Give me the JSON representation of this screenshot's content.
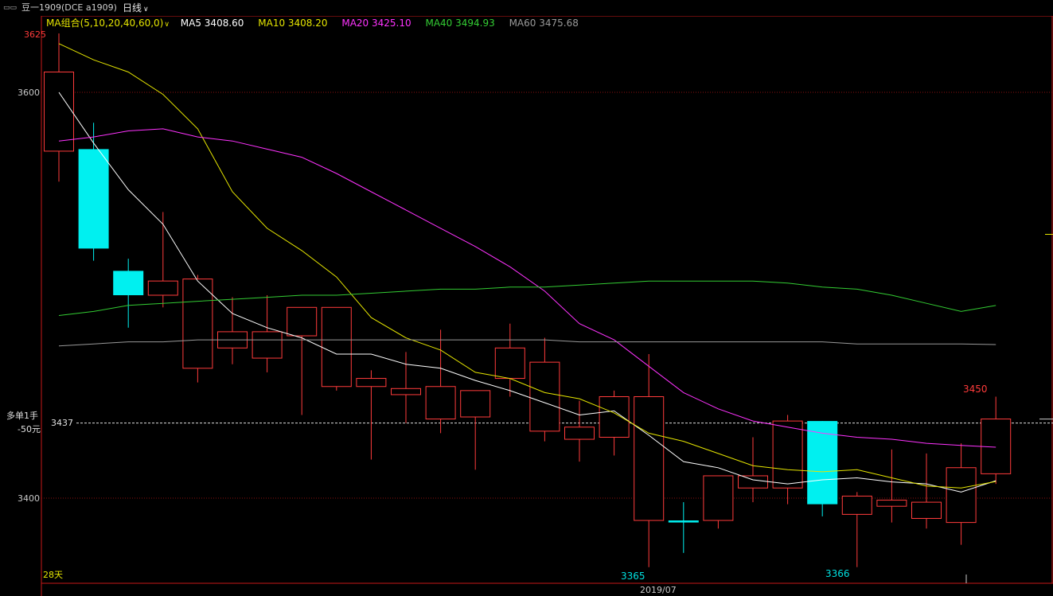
{
  "header": {
    "symbol_label": "豆一1909(DCE a1909)",
    "period_label": "日线",
    "ma_group_label": "MA组合(5,10,20,40,60,0)",
    "ma_values": [
      {
        "label": "MA5 3408.60",
        "color": "#ffffff"
      },
      {
        "label": "MA10 3408.20",
        "color": "#e5e500"
      },
      {
        "label": "MA20 3425.10",
        "color": "#ff33ff"
      },
      {
        "label": "MA40 3494.93",
        "color": "#33cc33"
      },
      {
        "label": "MA60 3475.68",
        "color": "#999999"
      }
    ]
  },
  "axis": {
    "ticks": [
      {
        "value": 3600,
        "label": "3600"
      },
      {
        "value": 3400,
        "label": "3400"
      }
    ],
    "top_label": "3625",
    "date_label": "2019/07",
    "bottom_left_label": "28天"
  },
  "position_box": {
    "line1": "多单1手",
    "line2": "-50元",
    "price_label": "3437",
    "price": 3437
  },
  "annotations": {
    "high_label": "3450",
    "low_label_1": "3365",
    "low_label_2": "3366"
  },
  "colors": {
    "up": "#ff3b3b",
    "down": "#00f0f0",
    "grid": "#8a1010",
    "frame": "#c81818"
  },
  "chart_data": {
    "type": "candlestick",
    "ylim": [
      3360,
      3640
    ],
    "candles": [
      {
        "o": 3571,
        "h": 3629,
        "l": 3556,
        "c": 3610
      },
      {
        "o": 3572,
        "h": 3585,
        "l": 3517,
        "c": 3523
      },
      {
        "o": 3512,
        "h": 3518,
        "l": 3484,
        "c": 3500
      },
      {
        "o": 3500,
        "h": 3541,
        "l": 3494,
        "c": 3507
      },
      {
        "o": 3464,
        "h": 3510,
        "l": 3457,
        "c": 3508
      },
      {
        "o": 3474,
        "h": 3499,
        "l": 3466,
        "c": 3482
      },
      {
        "o": 3469,
        "h": 3500,
        "l": 3462,
        "c": 3482
      },
      {
        "o": 3480,
        "h": 3494,
        "l": 3441,
        "c": 3494
      },
      {
        "o": 3455,
        "h": 3494,
        "l": 3453,
        "c": 3494
      },
      {
        "o": 3455,
        "h": 3463,
        "l": 3419,
        "c": 3459
      },
      {
        "o": 3451,
        "h": 3472,
        "l": 3437,
        "c": 3454
      },
      {
        "o": 3439,
        "h": 3483,
        "l": 3432,
        "c": 3455
      },
      {
        "o": 3440,
        "h": 3450,
        "l": 3414,
        "c": 3453
      },
      {
        "o": 3459,
        "h": 3486,
        "l": 3450,
        "c": 3474
      },
      {
        "o": 3433,
        "h": 3479,
        "l": 3428,
        "c": 3467
      },
      {
        "o": 3429,
        "h": 3448,
        "l": 3418,
        "c": 3435
      },
      {
        "o": 3430,
        "h": 3453,
        "l": 3421,
        "c": 3450
      },
      {
        "o": 3389,
        "h": 3471,
        "l": 3366,
        "c": 3450
      },
      {
        "o": 3389,
        "h": 3398,
        "l": 3373,
        "c": 3388
      },
      {
        "o": 3389,
        "h": 3410,
        "l": 3385,
        "c": 3411
      },
      {
        "o": 3405,
        "h": 3430,
        "l": 3398,
        "c": 3411
      },
      {
        "o": 3405,
        "h": 3441,
        "l": 3397,
        "c": 3438
      },
      {
        "o": 3438,
        "h": 3438,
        "l": 3391,
        "c": 3397
      },
      {
        "o": 3392,
        "h": 3403,
        "l": 3366,
        "c": 3401
      },
      {
        "o": 3396,
        "h": 3424,
        "l": 3388,
        "c": 3399
      },
      {
        "o": 3390,
        "h": 3422,
        "l": 3385,
        "c": 3398
      },
      {
        "o": 3388,
        "h": 3427,
        "l": 3377,
        "c": 3415
      },
      {
        "o": 3412,
        "h": 3450,
        "l": 3407,
        "c": 3439
      }
    ],
    "ma": [
      {
        "name": "MA5",
        "color": "#ffffff",
        "values": [
          3600,
          3575,
          3552,
          3535,
          3507,
          3491,
          3484,
          3479,
          3471,
          3471,
          3466,
          3464,
          3458,
          3453,
          3447,
          3441,
          3443,
          3431,
          3418,
          3415,
          3409,
          3407,
          3409,
          3410,
          3408,
          3407,
          3403,
          3408.6
        ]
      },
      {
        "name": "MA10",
        "color": "#e5e500",
        "values": [
          3624,
          3616,
          3610,
          3599,
          3582,
          3551,
          3533,
          3522,
          3509,
          3489,
          3479,
          3473,
          3462,
          3459,
          3452,
          3449,
          3442,
          3432,
          3428,
          3422,
          3416,
          3414,
          3413,
          3414,
          3410,
          3406,
          3405,
          3408.2
        ]
      },
      {
        "name": "MA20",
        "color": "#ff33ff",
        "values": [
          3576,
          3578,
          3581,
          3582,
          3578,
          3576,
          3572,
          3568,
          3560,
          3551,
          3542,
          3533,
          3524,
          3514,
          3502,
          3486,
          3478,
          3465,
          3452,
          3444,
          3438,
          3435,
          3432,
          3430,
          3429,
          3427,
          3426,
          3425.1
        ]
      },
      {
        "name": "MA40",
        "color": "#33cc33",
        "values": [
          3490,
          3492,
          3495,
          3496,
          3497,
          3498,
          3499,
          3500,
          3500,
          3501,
          3502,
          3503,
          3503,
          3504,
          3504,
          3505,
          3506,
          3507,
          3507,
          3507,
          3507,
          3506,
          3504,
          3503,
          3500,
          3496,
          3492,
          3494.93
        ]
      },
      {
        "name": "MA60",
        "color": "#999999",
        "values": [
          3475,
          3476,
          3477,
          3477,
          3478,
          3478,
          3478,
          3478,
          3478,
          3478,
          3478,
          3478,
          3478,
          3478,
          3478,
          3477,
          3477,
          3477,
          3477,
          3477,
          3477,
          3477,
          3477,
          3476,
          3476,
          3476,
          3476,
          3475.68
        ]
      }
    ]
  }
}
